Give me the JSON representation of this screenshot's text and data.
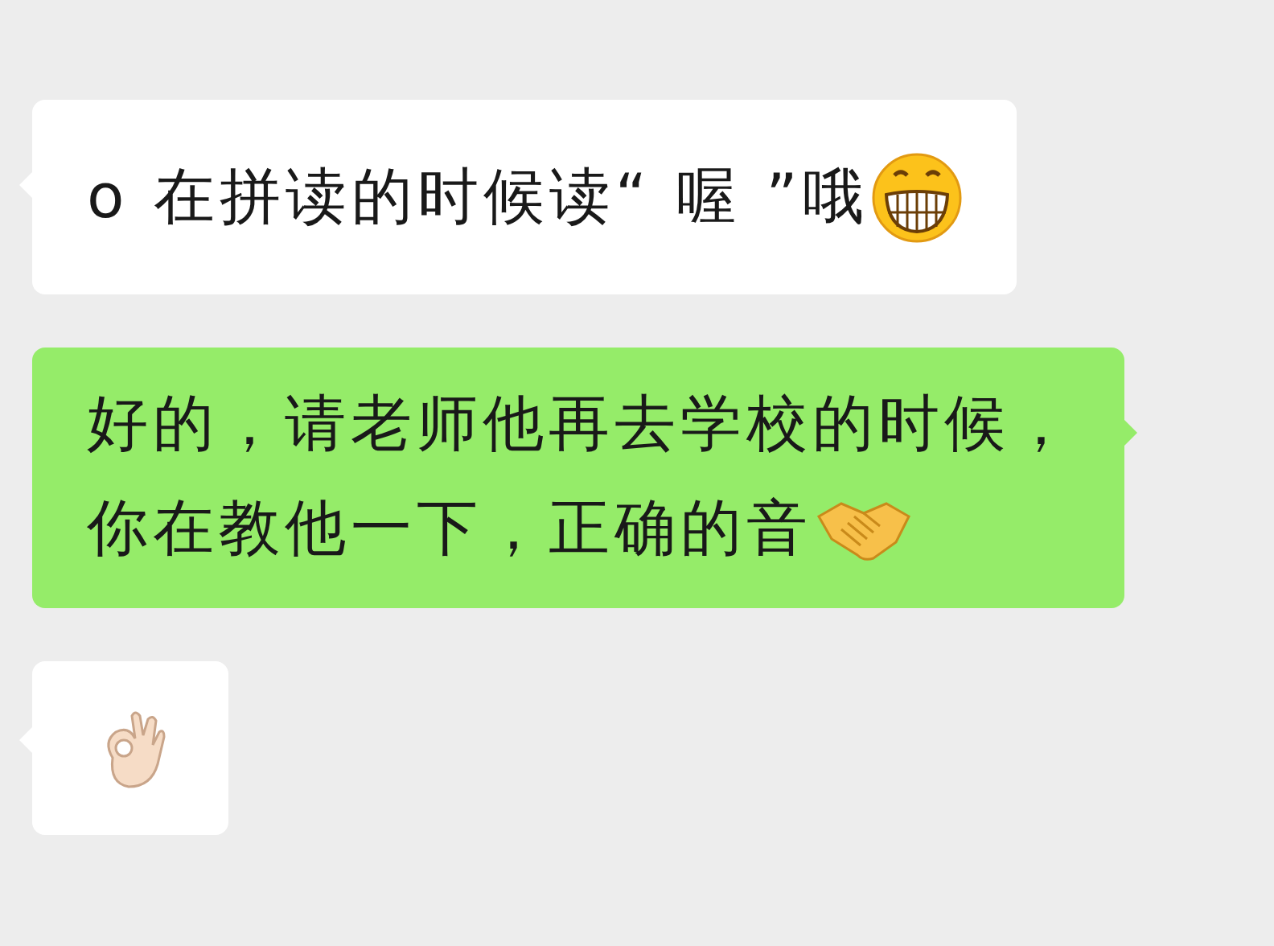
{
  "messages": [
    {
      "kind": "received",
      "lines": [
        "o  在拼读的时候读“ 喔 ”哦"
      ],
      "icon": {
        "kind": "grin"
      }
    },
    {
      "kind": "sent",
      "lines": [
        "好的，请老师他再去学校的时候，",
        "你在教他一下，正确的音"
      ],
      "icon": {
        "kind": "handshake"
      }
    },
    {
      "kind": "received",
      "icon": {
        "kind": "ok-hand"
      }
    }
  ]
}
